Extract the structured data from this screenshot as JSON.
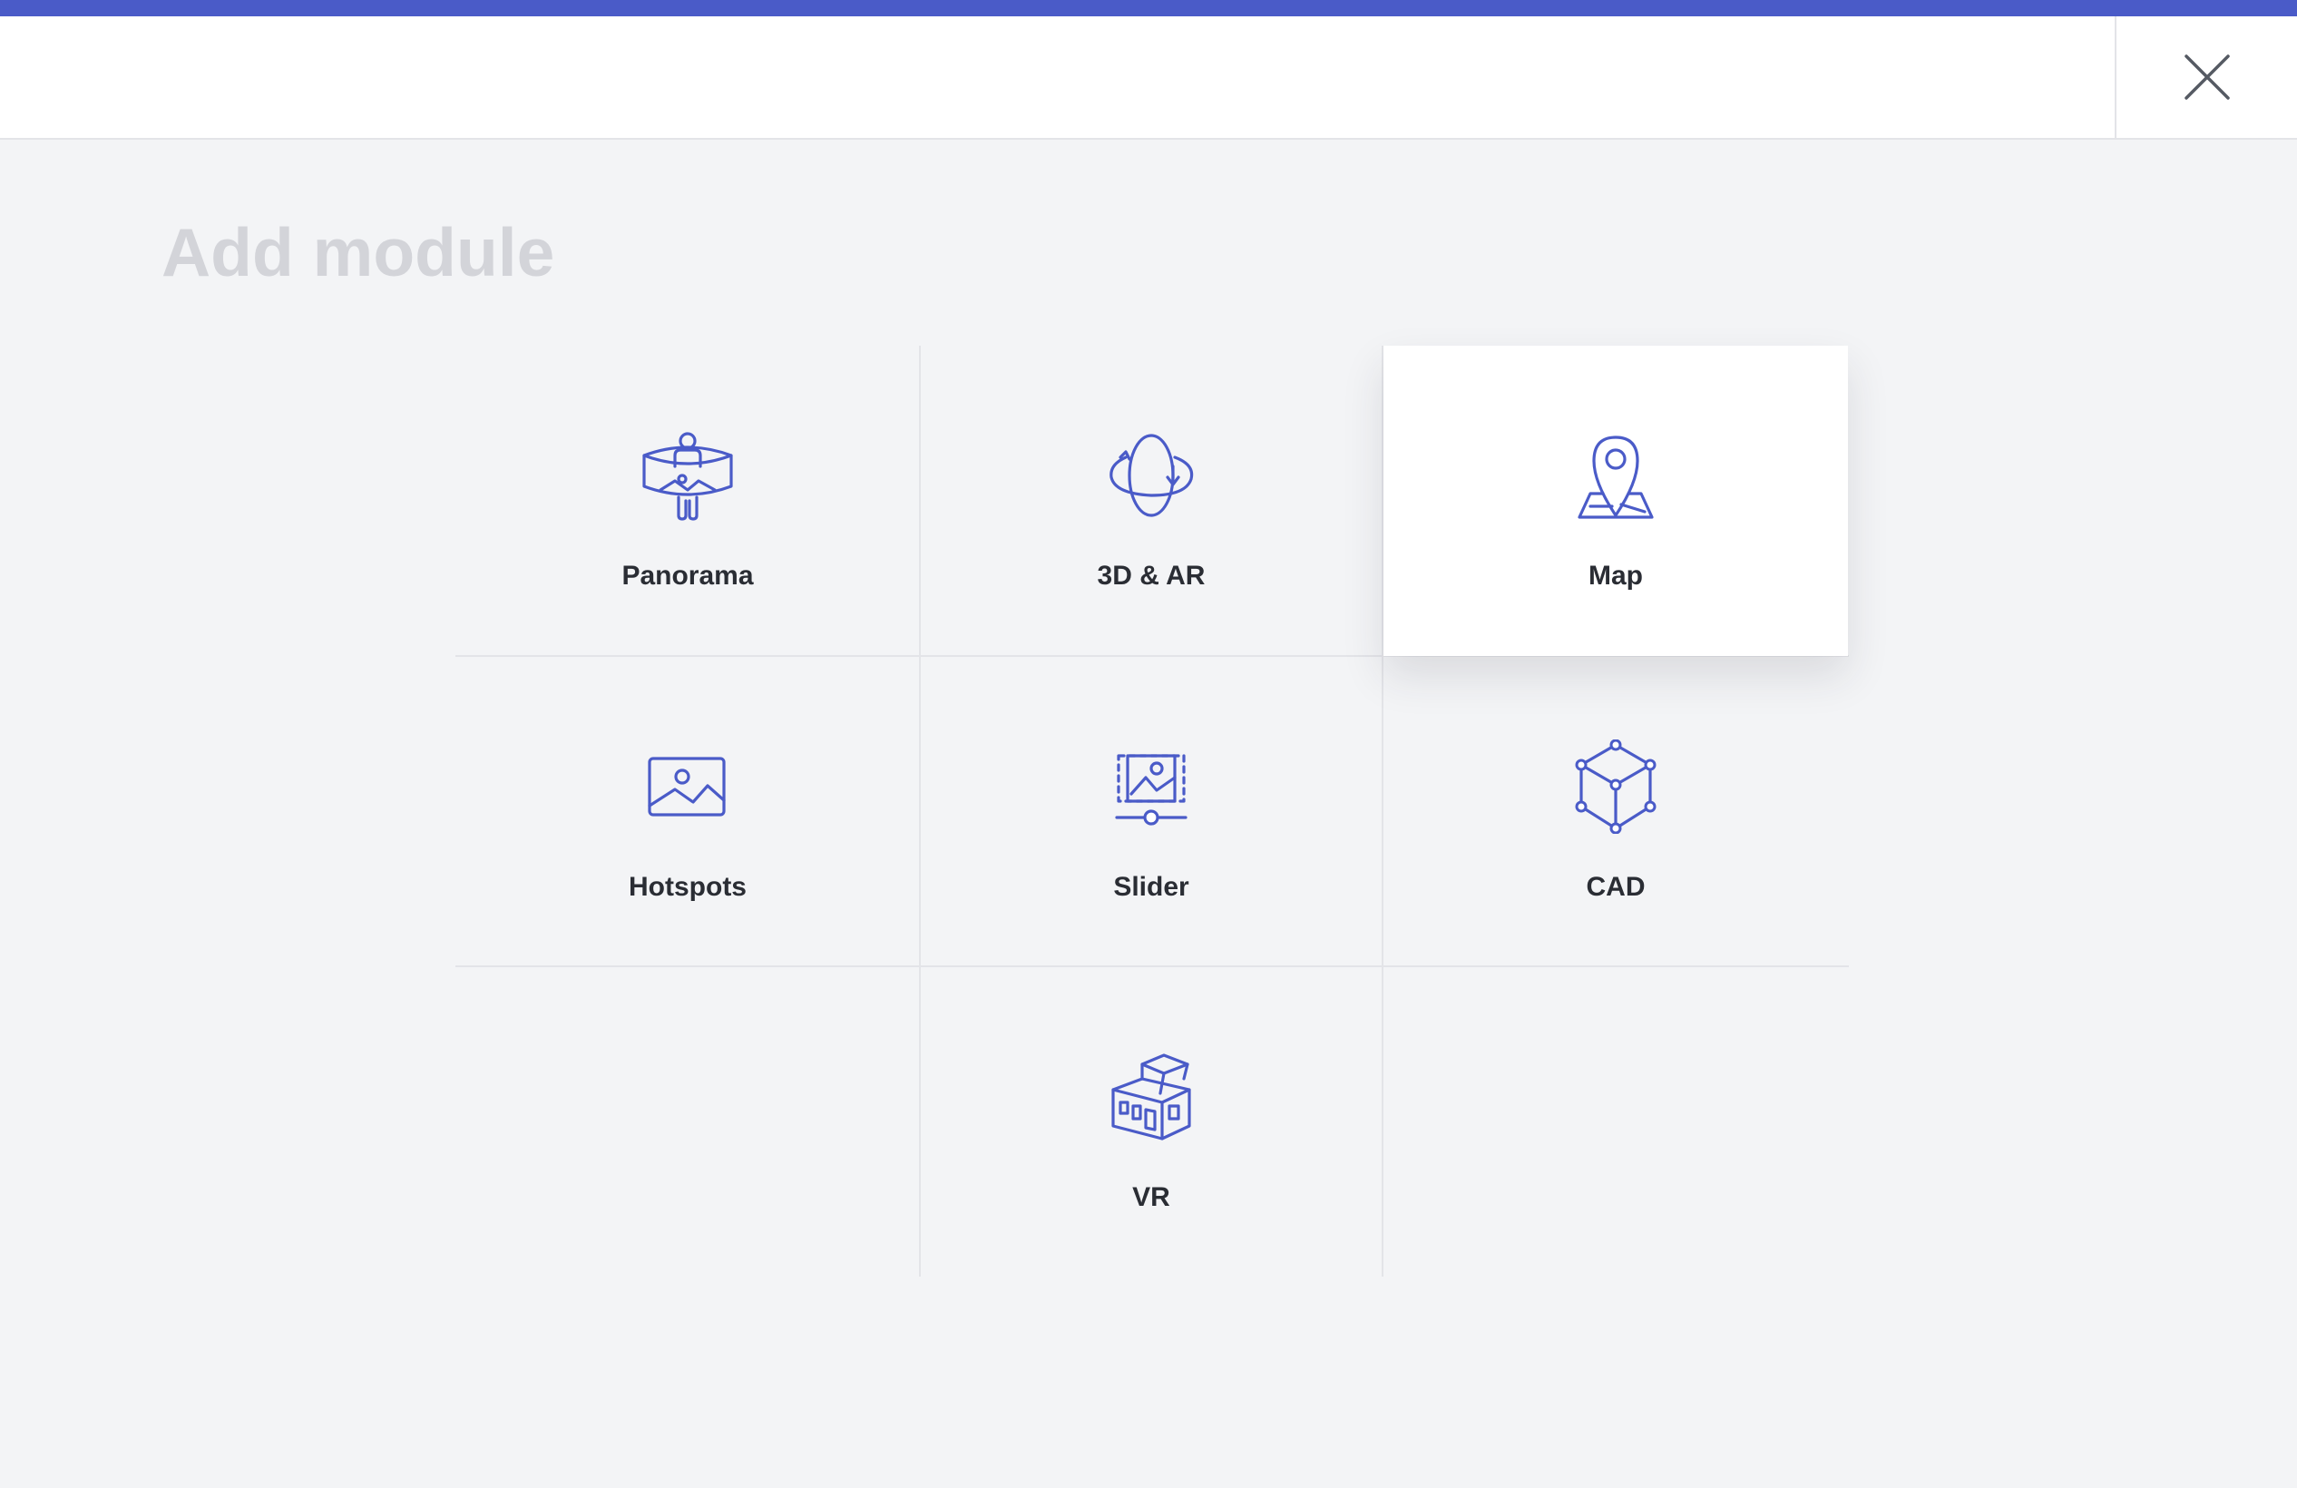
{
  "modal": {
    "title": "Add module",
    "close_icon": "close-icon"
  },
  "colors": {
    "accent": "#4a5bc8",
    "background": "#f3f4f6",
    "title": "#d3d4d9"
  },
  "modules": [
    {
      "label": "Panorama",
      "icon": "panorama-icon"
    },
    {
      "label": "3D & AR",
      "icon": "rotate-3d-icon"
    },
    {
      "label": "Map",
      "icon": "map-pin-icon",
      "highlighted": true
    },
    {
      "label": "Hotspots",
      "icon": "image-icon"
    },
    {
      "label": "Slider",
      "icon": "image-slider-icon"
    },
    {
      "label": "CAD",
      "icon": "cube-icon"
    },
    {
      "label": "VR",
      "icon": "building-icon"
    }
  ]
}
